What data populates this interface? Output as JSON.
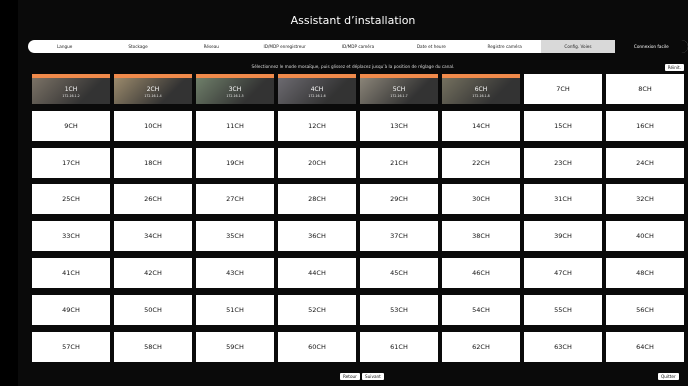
{
  "title": "Assistant d’installation",
  "steps": [
    {
      "label": "Langue"
    },
    {
      "label": "Stockage"
    },
    {
      "label": "Réseau"
    },
    {
      "label": "ID/MDP enregistreur"
    },
    {
      "label": "ID/MDP caméra"
    },
    {
      "label": "Date et heure"
    },
    {
      "label": "Registre caméra"
    },
    {
      "label": "Config. Voies"
    },
    {
      "label": "Connexion facile"
    }
  ],
  "instruction": "Sélectionnez le mode mosaïque, puis glissez et déplacez jusqu’à la position de réglage du canal.",
  "reset_label": "Réinit.",
  "cameras": [
    {
      "ch": "1CH",
      "ip": "172.16.1.2"
    },
    {
      "ch": "2CH",
      "ip": "172.16.1.4"
    },
    {
      "ch": "3CH",
      "ip": "172.16.1.5"
    },
    {
      "ch": "4CH",
      "ip": "172.16.1.6"
    },
    {
      "ch": "5CH",
      "ip": "172.16.1.7"
    },
    {
      "ch": "6CH",
      "ip": "172.16.1.8"
    }
  ],
  "channels": [
    "7CH",
    "8CH",
    "9CH",
    "10CH",
    "11CH",
    "12CH",
    "13CH",
    "14CH",
    "15CH",
    "16CH",
    "17CH",
    "18CH",
    "19CH",
    "20CH",
    "21CH",
    "22CH",
    "23CH",
    "24CH",
    "25CH",
    "26CH",
    "27CH",
    "28CH",
    "29CH",
    "30CH",
    "31CH",
    "32CH",
    "33CH",
    "34CH",
    "35CH",
    "36CH",
    "37CH",
    "38CH",
    "39CH",
    "40CH",
    "41CH",
    "42CH",
    "43CH",
    "44CH",
    "45CH",
    "46CH",
    "47CH",
    "48CH",
    "49CH",
    "50CH",
    "51CH",
    "52CH",
    "53CH",
    "54CH",
    "55CH",
    "56CH",
    "57CH",
    "58CH",
    "59CH",
    "60CH",
    "61CH",
    "62CH",
    "63CH",
    "64CH"
  ],
  "footer": {
    "back": "Retour",
    "next": "Suivant",
    "quit": "Quitter"
  }
}
